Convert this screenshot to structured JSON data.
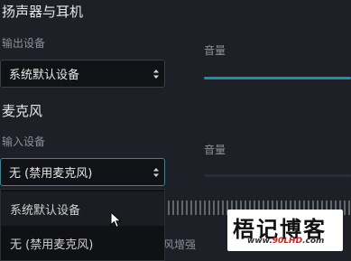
{
  "output": {
    "section_title": "扬声器与耳机",
    "device_label": "输出设备",
    "selected": "系统默认设备",
    "volume_label": "音量",
    "volume_level": 1.0
  },
  "input": {
    "section_title": "麦克风",
    "device_label": "输入设备",
    "selected": "无 (禁用麦克风)",
    "volume_label": "音量",
    "volume_level": 0.0,
    "options": [
      "系统默认设备",
      "无 (禁用麦克风)"
    ],
    "hovered_index": 0,
    "partial_label": "风增强"
  },
  "watermark": {
    "title": "梧记博客",
    "url_part1": "www.",
    "url_part2": "90LHD",
    "url_part3": ".com"
  },
  "colors": {
    "accent": "#1f8fa4",
    "background": "#1d2027"
  },
  "icons": [
    "updown-arrows-icon",
    "mouse-pointer-icon"
  ]
}
